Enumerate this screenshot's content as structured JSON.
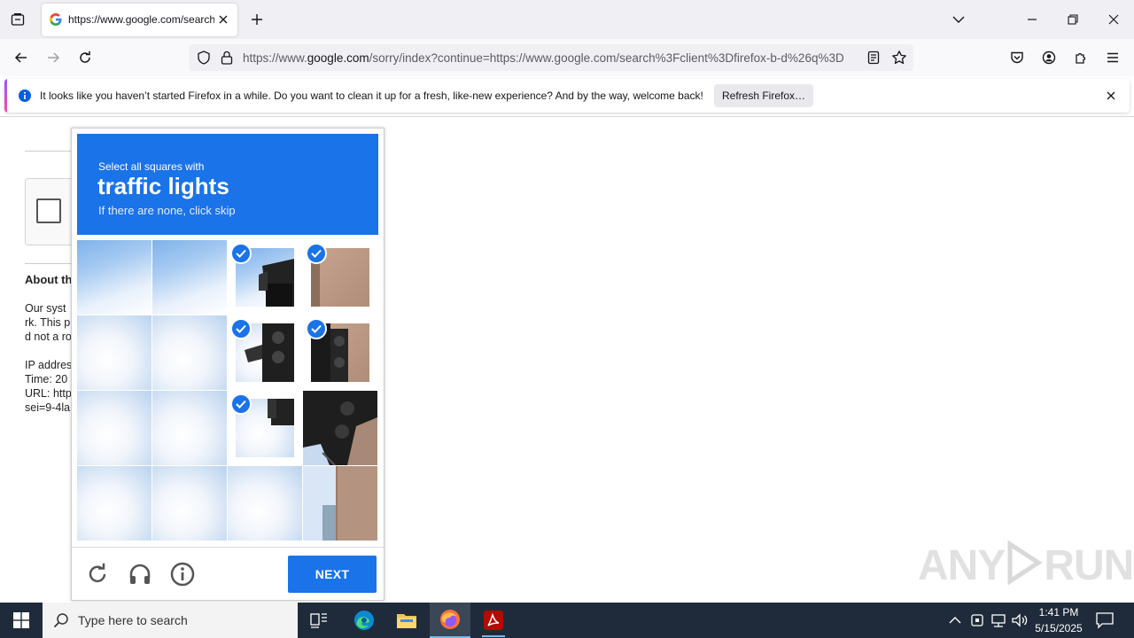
{
  "browser": {
    "tab_title": "https://www.google.com/search",
    "url_domain_prefix": "https://www.",
    "url_domain": "google.com",
    "url_rest": "/sorry/index?continue=https://www.google.com/search%3Fclient%3Dfirefox-b-d%26q%3D",
    "notification": {
      "message": "It looks like you haven’t started Firefox in a while. Do you want to clean it up for a fresh, like-new experience? And by the way, welcome back!",
      "button": "Refresh Firefox…"
    }
  },
  "page": {
    "heading_partial": "About th",
    "lines": [
      "Our syst",
      "rk. This p",
      "d not a ro"
    ],
    "info_lines": [
      "IP addres",
      "Time: 20",
      "URL: http",
      "sei=9-4la"
    ]
  },
  "captcha": {
    "instruction": "Select all squares with",
    "target": "traffic lights",
    "hint": "If there are none, click skip",
    "next_label": "NEXT",
    "selected_tiles": [
      2,
      3,
      6,
      7,
      10
    ]
  },
  "watermark": "ANY.RUN",
  "taskbar": {
    "search_placeholder": "Type here to search",
    "time": "1:41 PM",
    "date": "5/15/2025"
  }
}
